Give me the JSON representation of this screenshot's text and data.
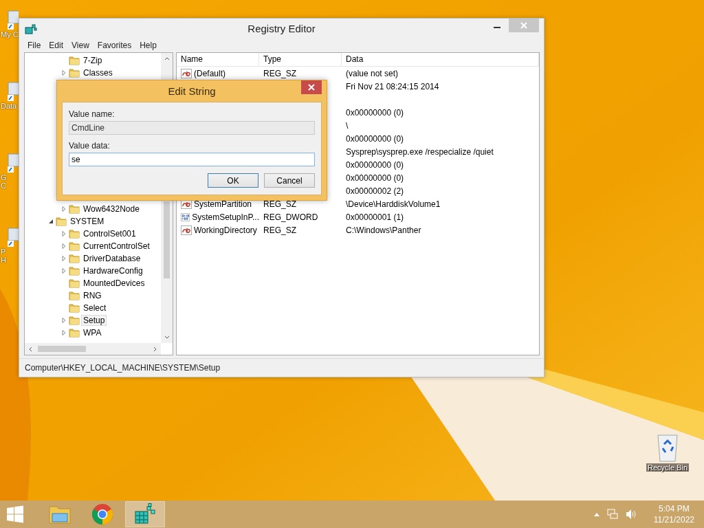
{
  "desktop_icons": [
    {
      "label_lines": [
        "My C"
      ]
    },
    {
      "label_lines": [
        "Data"
      ]
    },
    {
      "label_lines": [
        "G",
        "C"
      ]
    },
    {
      "label_lines": [
        "P",
        "H"
      ]
    },
    {
      "label_lines": [
        "Recycle Bin"
      ]
    }
  ],
  "window": {
    "title": "Registry Editor",
    "menu": [
      "File",
      "Edit",
      "View",
      "Favorites",
      "Help"
    ],
    "tree": [
      {
        "children": [
          {
            "label": "7-Zip",
            "selected": false
          },
          {
            "label": "Classes",
            "expanded": false,
            "selected": false
          },
          {
            "label": "Wow6432Node",
            "expanded": false,
            "selected": false
          }
        ]
      },
      {
        "label": "SYSTEM",
        "expanded": true,
        "selected": false,
        "children": [
          {
            "label": "ControlSet001",
            "expanded": false,
            "selected": false
          },
          {
            "label": "CurrentControlSet",
            "expanded": false,
            "selected": false
          },
          {
            "label": "DriverDatabase",
            "expanded": false,
            "selected": false
          },
          {
            "label": "HardwareConfig",
            "expanded": false,
            "selected": false
          },
          {
            "label": "MountedDevices",
            "selected": false
          },
          {
            "label": "RNG",
            "selected": false
          },
          {
            "label": "Select",
            "selected": false
          },
          {
            "label": "Setup",
            "expanded": false,
            "selected": true
          },
          {
            "label": "WPA",
            "expanded": false,
            "selected": false
          }
        ]
      }
    ],
    "table": {
      "columns": [
        "Name",
        "Type",
        "Data"
      ],
      "rows": [
        {
          "kind": "string",
          "name": "(Default)",
          "type": "REG_SZ",
          "data": "(value not set)"
        },
        {
          "data": "Fri Nov 21 08:24:15 2014"
        },
        {},
        {
          "data": "0x00000000 (0)"
        },
        {
          "data": "\\"
        },
        {
          "data": "0x00000000 (0)"
        },
        {
          "data": "Sysprep\\sysprep.exe /respecialize /quiet"
        },
        {
          "data": "0x00000000 (0)"
        },
        {
          "data": "0x00000000 (0)"
        },
        {
          "data": "0x00000002 (2)"
        },
        {
          "kind": "string",
          "name": "SystemPartition",
          "type": "REG_SZ",
          "data": "\\Device\\HarddiskVolume1"
        },
        {
          "kind": "binary",
          "name": "SystemSetupInP...",
          "type": "REG_DWORD",
          "data": "0x00000001 (1)"
        },
        {
          "kind": "string",
          "name": "WorkingDirectory",
          "type": "REG_SZ",
          "data": "C:\\Windows\\Panther"
        }
      ]
    },
    "status_bar": "Computer\\HKEY_LOCAL_MACHINE\\SYSTEM\\Setup"
  },
  "dialog": {
    "title": "Edit String",
    "fields": [
      {
        "label": "Value name:",
        "value": "CmdLine",
        "disabled": true
      },
      {
        "label": "Value data:",
        "value": "se",
        "disabled": false
      }
    ],
    "buttons": [
      {
        "label": "OK",
        "default": true
      },
      {
        "label": "Cancel",
        "default": false
      }
    ]
  },
  "taskbar": {
    "apps": [
      {
        "kind": "explorer",
        "active": false
      },
      {
        "kind": "chrome",
        "active": false
      },
      {
        "kind": "regedit",
        "active": true
      }
    ],
    "time": "5:04 PM",
    "date": "11/21/2022"
  }
}
